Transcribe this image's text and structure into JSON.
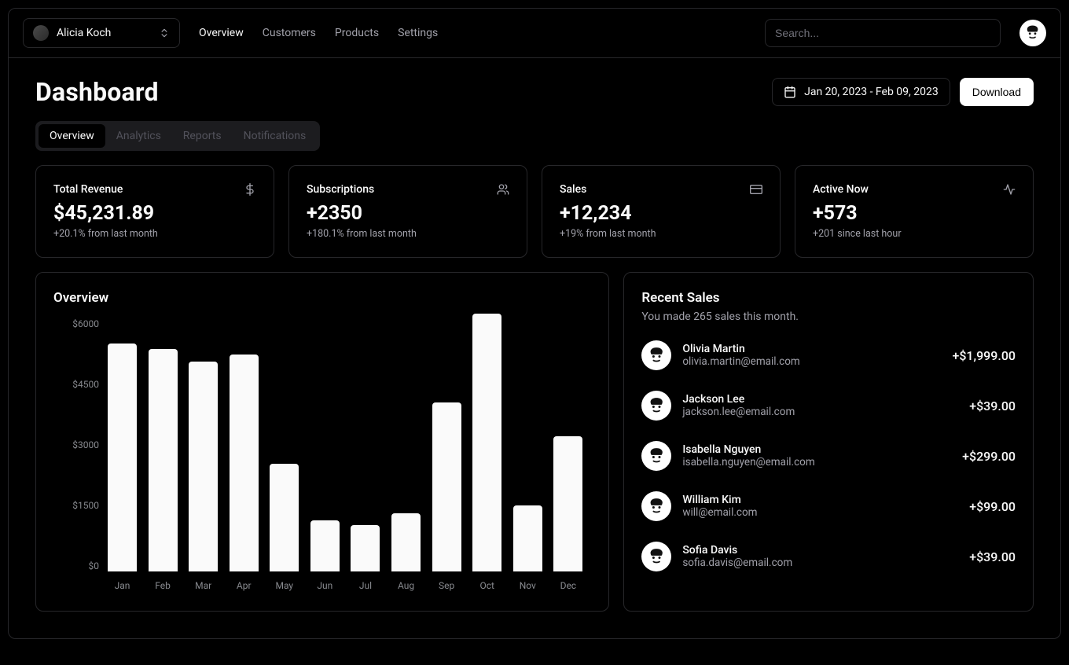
{
  "team": {
    "name": "Alicia Koch"
  },
  "nav": {
    "items": [
      "Overview",
      "Customers",
      "Products",
      "Settings"
    ],
    "active": "Overview"
  },
  "search": {
    "placeholder": "Search..."
  },
  "page": {
    "title": "Dashboard",
    "date_range": "Jan 20, 2023 - Feb 09, 2023",
    "download": "Download"
  },
  "tabs": {
    "items": [
      "Overview",
      "Analytics",
      "Reports",
      "Notifications"
    ],
    "active": "Overview"
  },
  "stats": [
    {
      "title": "Total Revenue",
      "value": "$45,231.89",
      "sub": "+20.1% from last month",
      "icon": "dollar"
    },
    {
      "title": "Subscriptions",
      "value": "+2350",
      "sub": "+180.1% from last month",
      "icon": "users"
    },
    {
      "title": "Sales",
      "value": "+12,234",
      "sub": "+19% from last month",
      "icon": "card"
    },
    {
      "title": "Active Now",
      "value": "+573",
      "sub": "+201 since last hour",
      "icon": "activity"
    }
  ],
  "overview_card": {
    "title": "Overview"
  },
  "chart_data": {
    "type": "bar",
    "categories": [
      "Jan",
      "Feb",
      "Mar",
      "Apr",
      "May",
      "Jun",
      "Jul",
      "Aug",
      "Sep",
      "Oct",
      "Nov",
      "Dec"
    ],
    "values": [
      5400,
      5280,
      4980,
      5150,
      2550,
      1220,
      1100,
      1380,
      4010,
      6120,
      1560,
      3200
    ],
    "yticks": [
      "$6000",
      "$4500",
      "$3000",
      "$1500",
      "$0"
    ],
    "ylim": [
      0,
      6000
    ],
    "title": "Overview",
    "xlabel": "",
    "ylabel": ""
  },
  "sales_card": {
    "title": "Recent Sales",
    "sub": "You made 265 sales this month."
  },
  "sales": [
    {
      "name": "Olivia Martin",
      "email": "olivia.martin@email.com",
      "amount": "+$1,999.00"
    },
    {
      "name": "Jackson Lee",
      "email": "jackson.lee@email.com",
      "amount": "+$39.00"
    },
    {
      "name": "Isabella Nguyen",
      "email": "isabella.nguyen@email.com",
      "amount": "+$299.00"
    },
    {
      "name": "William Kim",
      "email": "will@email.com",
      "amount": "+$99.00"
    },
    {
      "name": "Sofia Davis",
      "email": "sofia.davis@email.com",
      "amount": "+$39.00"
    }
  ]
}
